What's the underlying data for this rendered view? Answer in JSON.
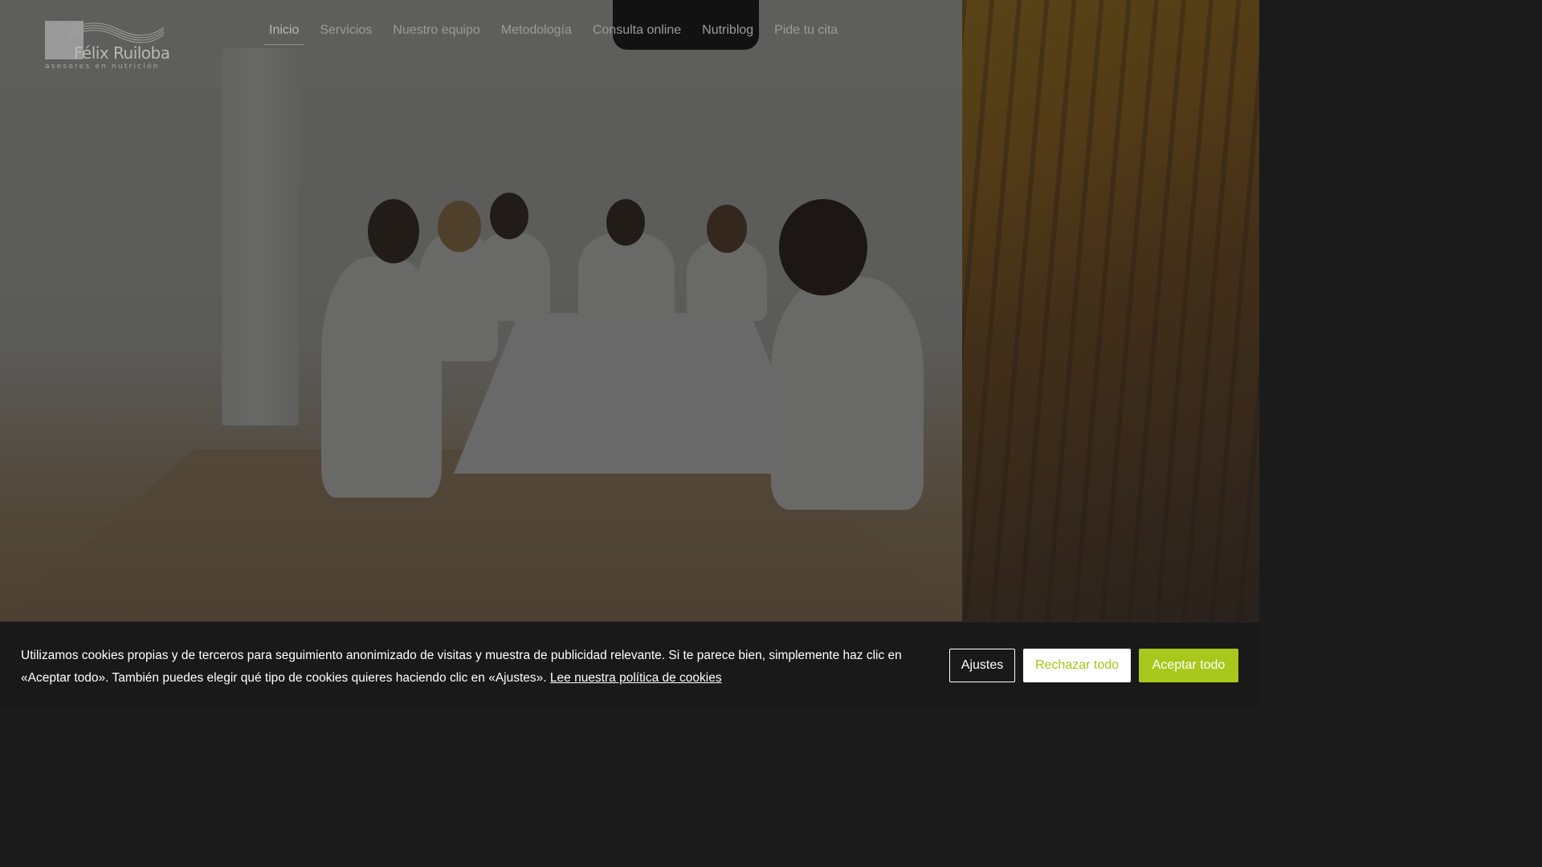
{
  "brand": {
    "name": "Félix Ruiloba",
    "tagline": "asesores en nutrición"
  },
  "nav": {
    "items": [
      {
        "label": "Inicio",
        "active": true
      },
      {
        "label": "Servicios"
      },
      {
        "label": "Nuestro equipo"
      },
      {
        "label": "Metodología"
      },
      {
        "label": "Consulta online"
      },
      {
        "label": "Nutriblog"
      },
      {
        "label": "Pide tu cita"
      }
    ]
  },
  "hero": {
    "image": "team-meeting-photo"
  },
  "cookie_banner": {
    "text": "Utilizamos cookies propias y de terceros para seguimiento anonimizado de visitas y muestra de publicidad relevante. Si te parece bien, simplemente haz clic en «Aceptar todo». También puedes elegir qué tipo de cookies quieres haciendo clic en «Ajustes».",
    "policy_link": "Lee nuestra política de cookies",
    "settings_label": "Ajustes",
    "reject_label": "Rechazar todo",
    "accept_label": "Aceptar todo"
  },
  "colors": {
    "accent": "#a9c81d",
    "banner_bg": "#191919"
  }
}
